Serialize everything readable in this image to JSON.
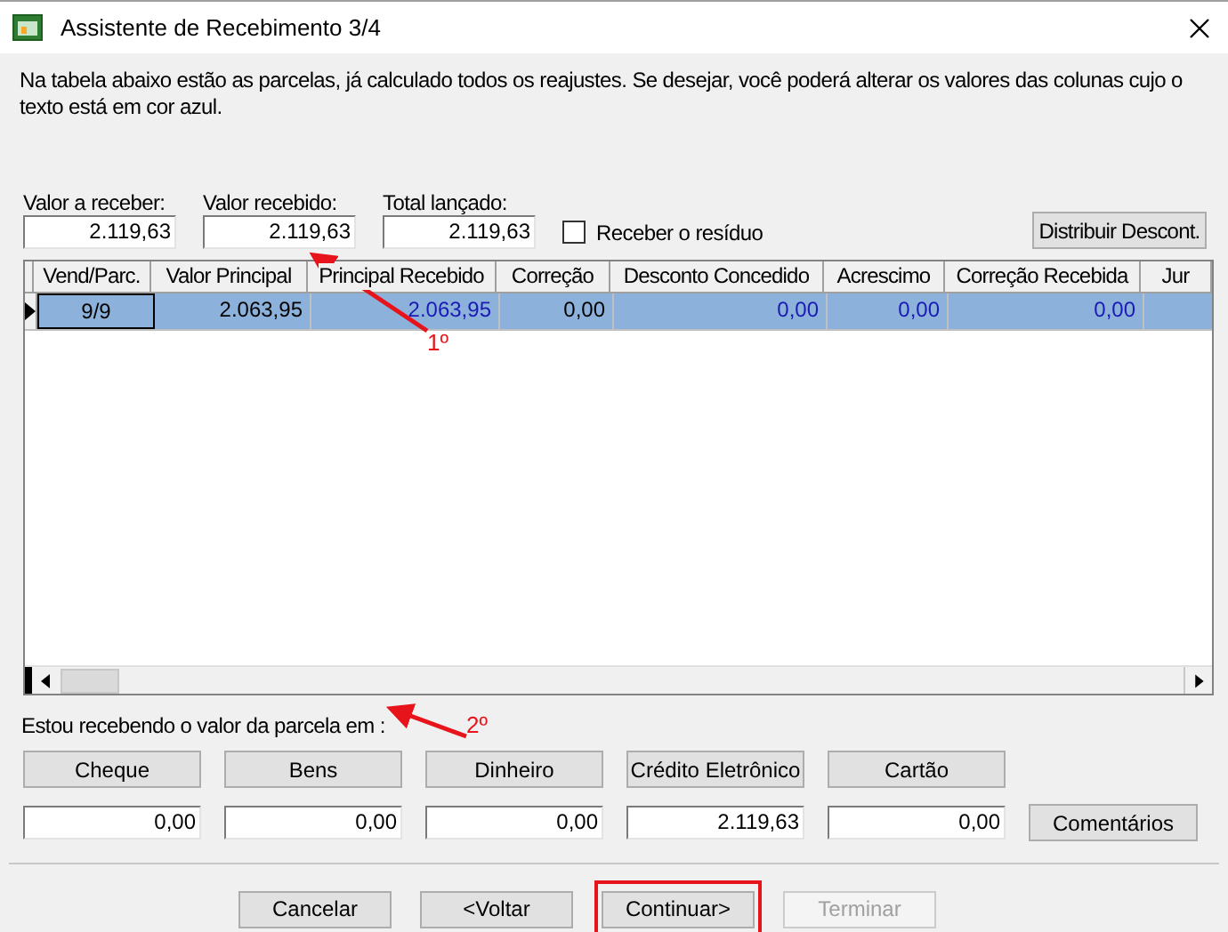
{
  "window": {
    "title": "Assistente de Recebimento 3/4"
  },
  "instructions": "Na tabela abaixo estão as parcelas, já calculado todos os reajustes. Se desejar, você poderá alterar os valores das colunas cujo o texto está em cor azul.",
  "totals": [
    {
      "label": "Valor a receber:",
      "value": "2.119,63"
    },
    {
      "label": "Valor recebido:",
      "value": "2.119,63"
    },
    {
      "label": "Total lançado:",
      "value": "2.119,63"
    }
  ],
  "residue_checkbox": {
    "label": "Receber o resíduo",
    "checked": false
  },
  "distribute_button": "Distribuir Descont.",
  "table": {
    "columns": [
      "Vend/Parc.",
      "Valor Principal",
      "Principal Recebido",
      "Correção",
      "Desconto Concedido",
      "Acrescimo",
      "Correção Recebida",
      "Jur"
    ],
    "rows": [
      {
        "selected": true,
        "cells": [
          {
            "text": "9/9",
            "editable": false
          },
          {
            "text": "2.063,95",
            "editable": false
          },
          {
            "text": "2.063,95",
            "editable": true
          },
          {
            "text": "0,00",
            "editable": false
          },
          {
            "text": "0,00",
            "editable": true
          },
          {
            "text": "0,00",
            "editable": true
          },
          {
            "text": "0,00",
            "editable": true
          }
        ]
      }
    ]
  },
  "payment_prompt": "Estou recebendo o valor da parcela em :",
  "payment_methods": [
    {
      "label": "Cheque",
      "value": "0,00"
    },
    {
      "label": "Bens",
      "value": "0,00"
    },
    {
      "label": "Dinheiro",
      "value": "0,00"
    },
    {
      "label": "Crédito Eletrônico",
      "value": "2.119,63"
    },
    {
      "label": "Cartão",
      "value": "0,00"
    }
  ],
  "comments_button": "Comentários",
  "footer_buttons": [
    {
      "label": "Cancelar",
      "disabled": false,
      "highlighted": false
    },
    {
      "label": "<Voltar",
      "disabled": false,
      "highlighted": false
    },
    {
      "label": "Continuar>",
      "disabled": false,
      "highlighted": true
    },
    {
      "label": "Terminar",
      "disabled": true,
      "highlighted": false
    }
  ],
  "annotations": [
    {
      "label": "1º"
    },
    {
      "label": "2º"
    }
  ]
}
